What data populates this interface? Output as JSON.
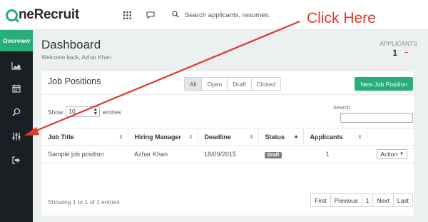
{
  "app": {
    "logo_text": "neRecruit"
  },
  "topbar": {
    "search_placeholder": "Search applicants, resumes."
  },
  "sidebar": {
    "overview_label": "Overview",
    "icons": [
      "chart-icon",
      "calendar-icon",
      "search-icon",
      "sliders-icon",
      "sign-out-icon"
    ]
  },
  "header": {
    "title": "Dashboard",
    "subtitle": "Welcome back, Azhar Khan"
  },
  "stats": {
    "applicants_label": "APPLICANTS",
    "applicants_value": "1"
  },
  "card": {
    "title": "Job Positions",
    "filters": [
      "All",
      "Open",
      "Draft",
      "Closed"
    ],
    "active_filter": "All",
    "new_button": "New Job Position",
    "show_label": "Show",
    "show_value": "10",
    "entries_label": "entries",
    "search_label": "Search:",
    "columns": [
      "Job Title",
      "Hiring Manager",
      "Deadline",
      "Status",
      "Applicants"
    ],
    "rows": [
      {
        "title": "Sample job position",
        "manager": "Azhar Khan",
        "deadline": "18/09/2015",
        "status": "Draft",
        "applicants": "1",
        "action": "Action"
      }
    ],
    "info": "Showing 1 to 1 of 1 entries",
    "pager": [
      "First",
      "Previous",
      "1",
      "Next",
      "Last"
    ]
  },
  "annotation": {
    "text": "Click Here",
    "color": "#e03a2a"
  },
  "colors": {
    "accent": "#27ae7a",
    "sidebar": "#1c1f22",
    "annotation": "#e03a2a"
  }
}
